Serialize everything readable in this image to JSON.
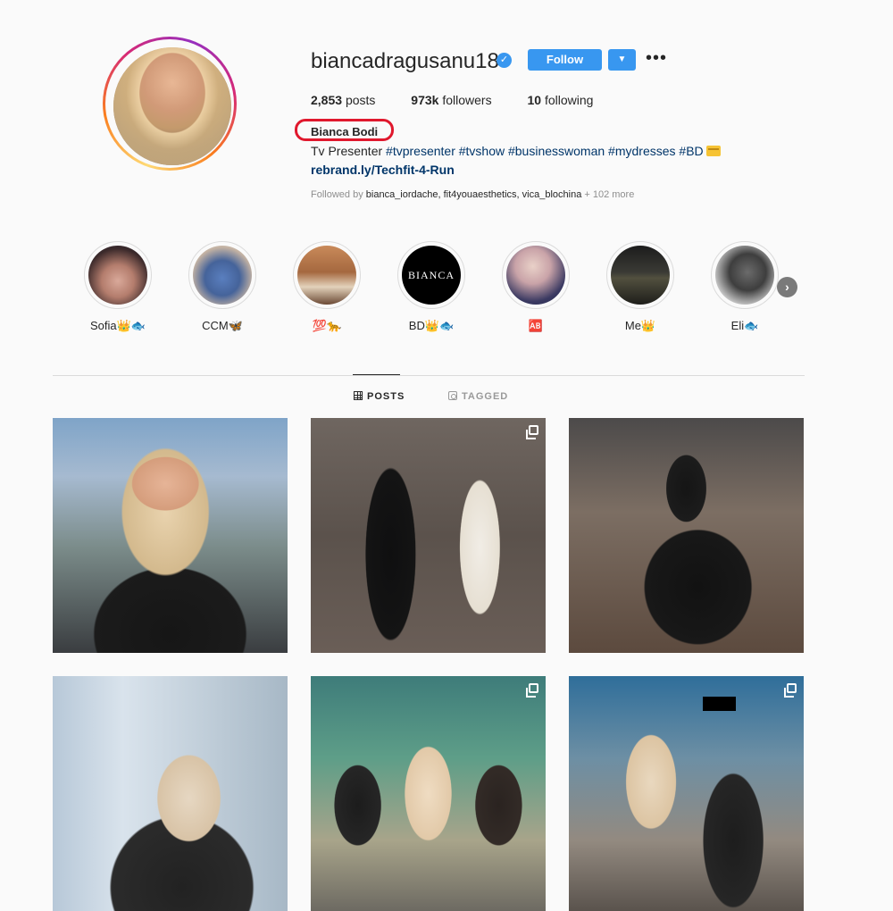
{
  "profile": {
    "username": "biancadragusanu18",
    "verified_icon": "verified-badge-icon",
    "follow_label": "Follow",
    "dropdown_icon": "▼",
    "more_icon": "•••",
    "stats": {
      "posts_count": "2,853",
      "posts_label": "posts",
      "followers_count": "973k",
      "followers_label": "followers",
      "following_count": "10",
      "following_label": "following"
    },
    "full_name": "Bianca Bodi",
    "bio_text": "Tv Presenter ",
    "bio_hashtags": "#tvpresenter #tvshow #businesswoman #mydresses #BD",
    "link": "rebrand.ly/Techfit-4-Run",
    "followed_by_prefix": "Followed by ",
    "followed_by_names": "bianca_iordache, fit4youaesthetics, vica_blochina",
    "followed_by_more": " + 102 more"
  },
  "highlights": [
    {
      "label": "Sofia👑🐟"
    },
    {
      "label": "CCM🦋"
    },
    {
      "label": "💯🐆"
    },
    {
      "label": "BD👑🐟"
    },
    {
      "label": "🆎"
    },
    {
      "label": "Me👑"
    },
    {
      "label": "Eli🐟"
    }
  ],
  "tabs": {
    "posts": "POSTS",
    "tagged": "TAGGED"
  },
  "colors": {
    "accent": "#3897f0",
    "link": "#003569",
    "highlight_box": "#e0182d"
  }
}
